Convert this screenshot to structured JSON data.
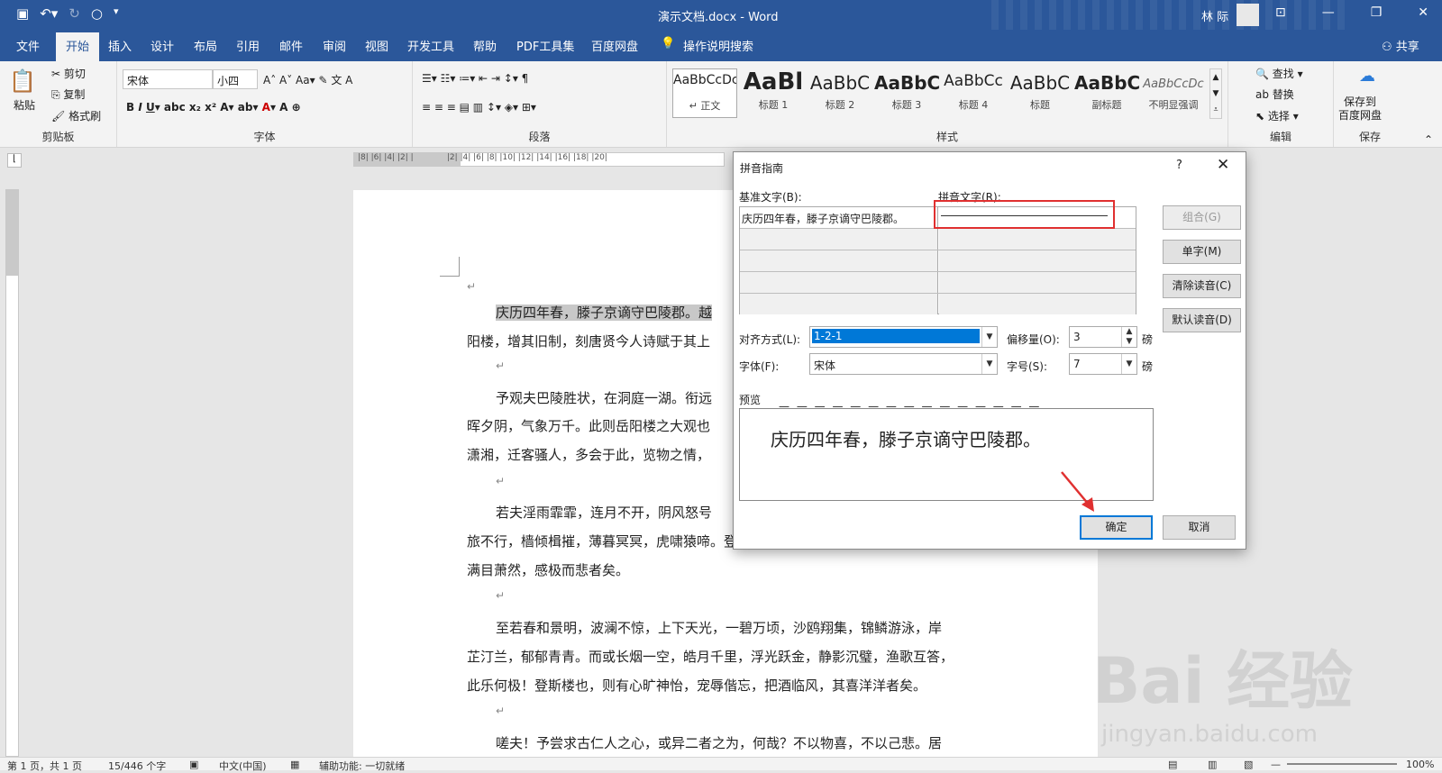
{
  "window": {
    "title": "演示文档.docx - Word",
    "user": "林 际"
  },
  "tabs": [
    "文件",
    "开始",
    "插入",
    "设计",
    "布局",
    "引用",
    "邮件",
    "审阅",
    "视图",
    "开发工具",
    "帮助",
    "PDF工具集",
    "百度网盘",
    "操作说明搜索"
  ],
  "share": "共享",
  "ribbon": {
    "clipboard": {
      "paste": "粘贴",
      "cut": "剪切",
      "copy": "复制",
      "format_painter": "格式刷",
      "label": "剪贴板"
    },
    "font": {
      "name": "宋体",
      "size": "小四",
      "label": "字体"
    },
    "paragraph": {
      "label": "段落"
    },
    "styles": {
      "items": [
        {
          "preview": "AaBbCcDc",
          "label": "↵ 正文"
        },
        {
          "preview": "AaBl",
          "label": "标题 1"
        },
        {
          "preview": "AaBbC",
          "label": "标题 2"
        },
        {
          "preview": "AaBbC",
          "label": "标题 3"
        },
        {
          "preview": "AaBbCc",
          "label": "标题 4"
        },
        {
          "preview": "AaBbC",
          "label": "标题"
        },
        {
          "preview": "AaBbC",
          "label": "副标题"
        },
        {
          "preview": "AaBbCcDc",
          "label": "不明显强调"
        }
      ],
      "label": "样式"
    },
    "editing": {
      "find": "查找",
      "replace": "替换",
      "select": "选择",
      "label": "编辑"
    },
    "save": {
      "button": "保存到\n百度网盘",
      "label": "保存"
    }
  },
  "document": {
    "lines": [
      "庆历四年春，滕子京谪守巴陵郡。越",
      "阳楼，增其旧制，刻唐贤今人诗赋于其上",
      "予观夫巴陵胜状，在洞庭一湖。衔远",
      "晖夕阴，气象万千。此则岳阳楼之大观也",
      "潇湘，迁客骚人，多会于此，览物之情，",
      "若夫淫雨霏霏，连月不开，阴风怒号",
      "旅不行，樯倾楫摧，薄暮冥冥，虎啸猿啼。登斯楼也，则有去国怀乡，忧谗畏讥，",
      "满目萧然，感极而悲者矣。",
      "至若春和景明，波澜不惊，上下天光，一碧万顷，沙鸥翔集，锦鳞游泳，岸",
      "芷汀兰，郁郁青青。而或长烟一空，皓月千里，浮光跃金，静影沉璧，渔歌互答，",
      "此乐何极！登斯楼也，则有心旷神怡，宠辱偕忘，把酒临风，其喜洋洋者矣。",
      "嗟夫！予尝求古仁人之心，或异二者之为，何哉？不以物喜，不以己悲。居"
    ]
  },
  "dialog": {
    "title": "拼音指南",
    "help": "?",
    "base_text_label": "基准文字(B):",
    "ruby_text_label": "拼音文字(R):",
    "base_text": "庆历四年春，滕子京谪守巴陵郡。",
    "buttons": {
      "group": "组合(G)",
      "single": "单字(M)",
      "clear": "清除读音(C)",
      "default": "默认读音(D)",
      "ok": "确定",
      "cancel": "取消"
    },
    "alignment_label": "对齐方式(L):",
    "alignment_value": "1-2-1",
    "offset_label": "偏移量(O):",
    "offset_value": "3",
    "offset_unit": "磅",
    "font_label": "字体(F):",
    "font_value": "宋体",
    "size_label": "字号(S):",
    "size_value": "7",
    "size_unit": "磅",
    "preview_label": "预览",
    "preview_text": "庆历四年春，滕子京谪守巴陵郡。",
    "preview_dashes": "— — — — — — — — — — — — — — —"
  },
  "status": {
    "page": "第 1 页，共 1 页",
    "words": "15/446 个字",
    "lang": "中文(中国)",
    "access": "辅助功能: 一切就绪",
    "zoom": "100%"
  },
  "watermark": {
    "brand": "Bai 经验",
    "url": "jingyan.baidu.com"
  },
  "colors": {
    "accent": "#2b579a",
    "highlight_border": "#e03030",
    "selection": "#0078d7"
  }
}
